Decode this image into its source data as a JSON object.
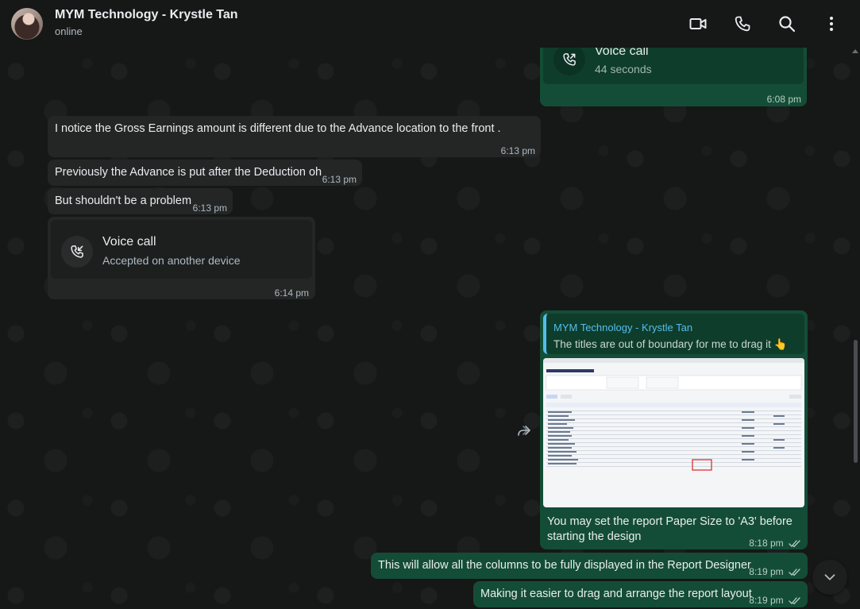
{
  "header": {
    "contact_name": "MYM Technology - Krystle Tan",
    "status": "online",
    "icons": [
      "video-call-icon",
      "voice-call-icon",
      "search-icon",
      "more-options-icon"
    ]
  },
  "messages": {
    "m0_call": {
      "title": "Voice call",
      "subtitle": "44 seconds",
      "time": "6:08 pm"
    },
    "m1": {
      "text": "I notice the Gross Earnings amount is different due to the Advance location to the front .",
      "time": "6:13 pm"
    },
    "m2": {
      "text": "Previously the Advance is put after the Deduction oh",
      "time": "6:13 pm"
    },
    "m3": {
      "text": "But shouldn't be a problem",
      "time": "6:13 pm"
    },
    "m4_call": {
      "title": "Voice call",
      "subtitle": "Accepted on another device",
      "time": "6:14 pm"
    },
    "m5": {
      "quote_author": "MYM Technology - Krystle Tan",
      "quote_text": "The titles are out of boundary for me to drag it 👆",
      "thumb_title": "Payroll Monthly Summary",
      "text_line1": "You may set the report Paper Size to 'A3' before",
      "text_line2": "starting the design",
      "time": "8:18 pm"
    },
    "m6": {
      "text": "This will allow all the columns to be fully displayed in the Report Designer",
      "time": "8:19 pm"
    },
    "m7": {
      "text": "Making it easier to drag and arrange the report layout",
      "time": "8:19 pm"
    }
  },
  "colors": {
    "incoming_bubble": "#242626",
    "outgoing_bubble": "#144d37",
    "quote_accent": "#53bdeb",
    "background": "#161717"
  }
}
